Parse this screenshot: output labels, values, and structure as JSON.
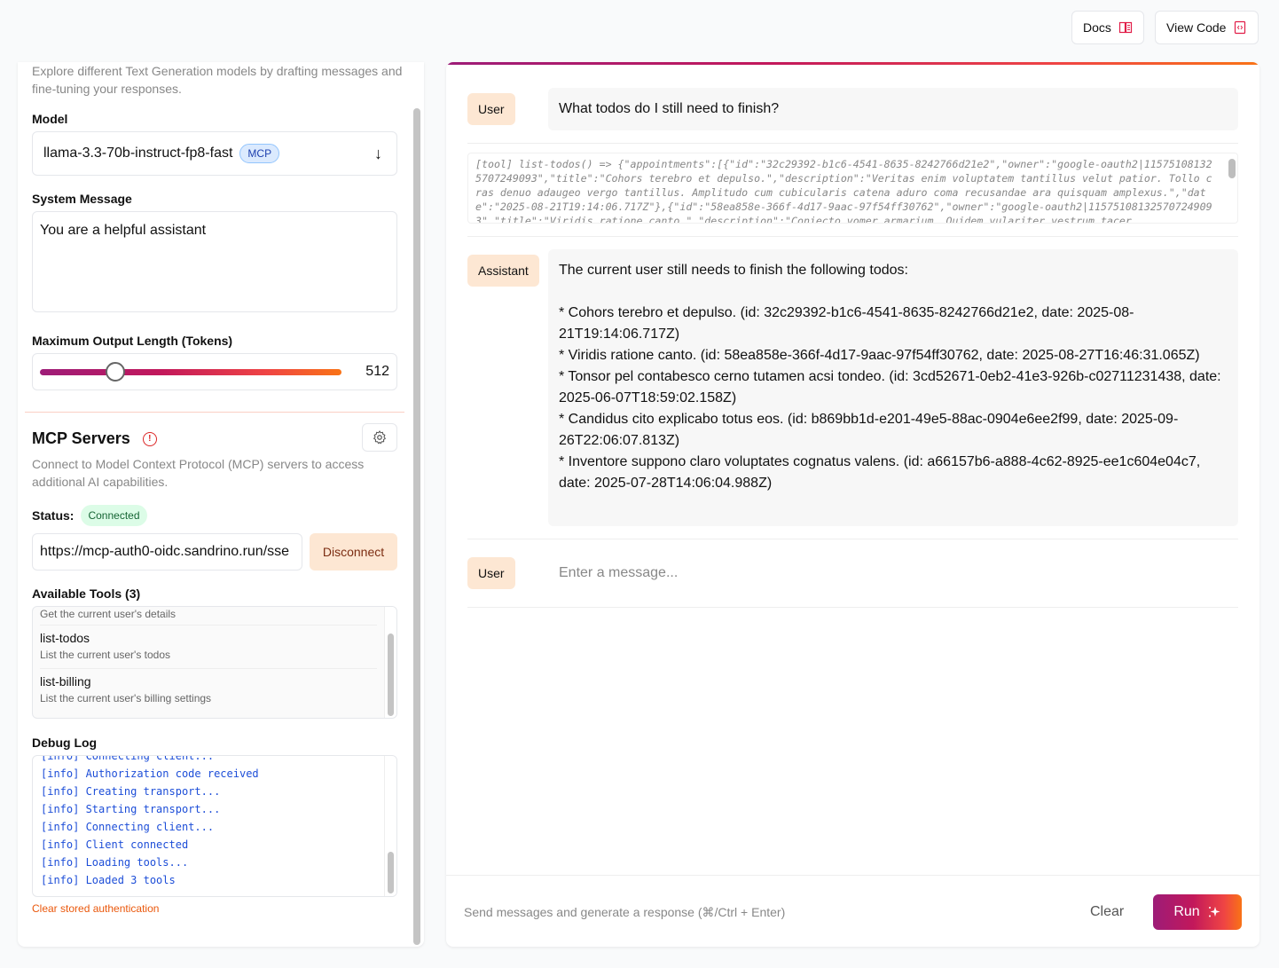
{
  "topbar": {
    "docs_label": "Docs",
    "view_code_label": "View Code"
  },
  "left": {
    "intro": "Explore different Text Generation models by drafting messages and fine-tuning your responses.",
    "model_label": "Model",
    "model_value": "llama-3.3-70b-instruct-fp8-fast",
    "model_badge": "MCP",
    "system_label": "System Message",
    "system_value": "You are a helpful assistant",
    "maxlen_label": "Maximum Output Length (Tokens)",
    "maxlen_value": "512",
    "maxlen_fraction": 0.25,
    "mcp_title": "MCP Servers",
    "mcp_desc": "Connect to Model Context Protocol (MCP) servers to access additional AI capabilities.",
    "status_label": "Status:",
    "status_value": "Connected",
    "server_url": "https://mcp-auth0-oidc.sandrino.run/sse",
    "disconnect_label": "Disconnect",
    "tools_label": "Available Tools (3)",
    "tools": [
      {
        "name": "",
        "description": "Get the current user's details"
      },
      {
        "name": "list-todos",
        "description": "List the current user's todos"
      },
      {
        "name": "list-billing",
        "description": "List the current user's billing settings"
      }
    ],
    "debug_label": "Debug Log",
    "debug_lines": [
      "[info] Connecting client...",
      "[info] Authorization code received",
      "[info] Creating transport...",
      "[info] Starting transport...",
      "[info] Connecting client...",
      "[info] Client connected",
      "[info] Loading tools...",
      "[info] Loaded 3 tools"
    ],
    "clear_auth_label": "Clear stored authentication"
  },
  "chat": {
    "user_role": "User",
    "assistant_role": "Assistant",
    "user_message": "What todos do I still need to finish?",
    "tool_output": "[tool] list-todos() => {\"appointments\":[{\"id\":\"32c29392-b1c6-4541-8635-8242766d21e2\",\"owner\":\"google-oauth2|115751081325707249093\",\"title\":\"Cohors terebro et depulso.\",\"description\":\"Veritas enim voluptatem tantillus velut patior. Tollo cras denuo adaugeo vergo tantillus. Amplitudo cum cubicularis catena aduro coma recusandae ara quisquam amplexus.\",\"date\":\"2025-08-21T19:14:06.717Z\"},{\"id\":\"58ea858e-366f-4d17-9aac-97f54ff30762\",\"owner\":\"google-oauth2|115751081325707249093\",\"title\":\"Viridis ratione canto.\",\"description\":\"Coniecto vomer armarium. Quidem vulariter vestrum tacer",
    "assistant_lines": [
      "The current user still needs to finish the following todos:",
      "",
      "* Cohors terebro et depulso. (id: 32c29392-b1c6-4541-8635-8242766d21e2, date: 2025-08-21T19:14:06.717Z)",
      "* Viridis ratione canto. (id: 58ea858e-366f-4d17-9aac-97f54ff30762, date: 2025-08-27T16:46:31.065Z)",
      "* Tonsor pel contabesco cerno tutamen acsi tondeo. (id: 3cd52671-0eb2-41e3-926b-c02711231438, date: 2025-06-07T18:59:02.158Z)",
      "* Candidus cito explicabo totus eos. (id: b869bb1d-e201-49e5-88ac-0904e6ee2f99, date: 2025-09-26T22:06:07.813Z)",
      "* Inventore suppono claro voluptates cognatus valens. (id: a66157b6-a888-4c62-8925-ee1c604e04c7, date: 2025-07-28T14:06:04.988Z)"
    ],
    "input_placeholder": "Enter a message...",
    "footer_hint": "Send messages and generate a response (⌘/Ctrl + Enter)",
    "clear_label": "Clear",
    "run_label": "Run"
  }
}
